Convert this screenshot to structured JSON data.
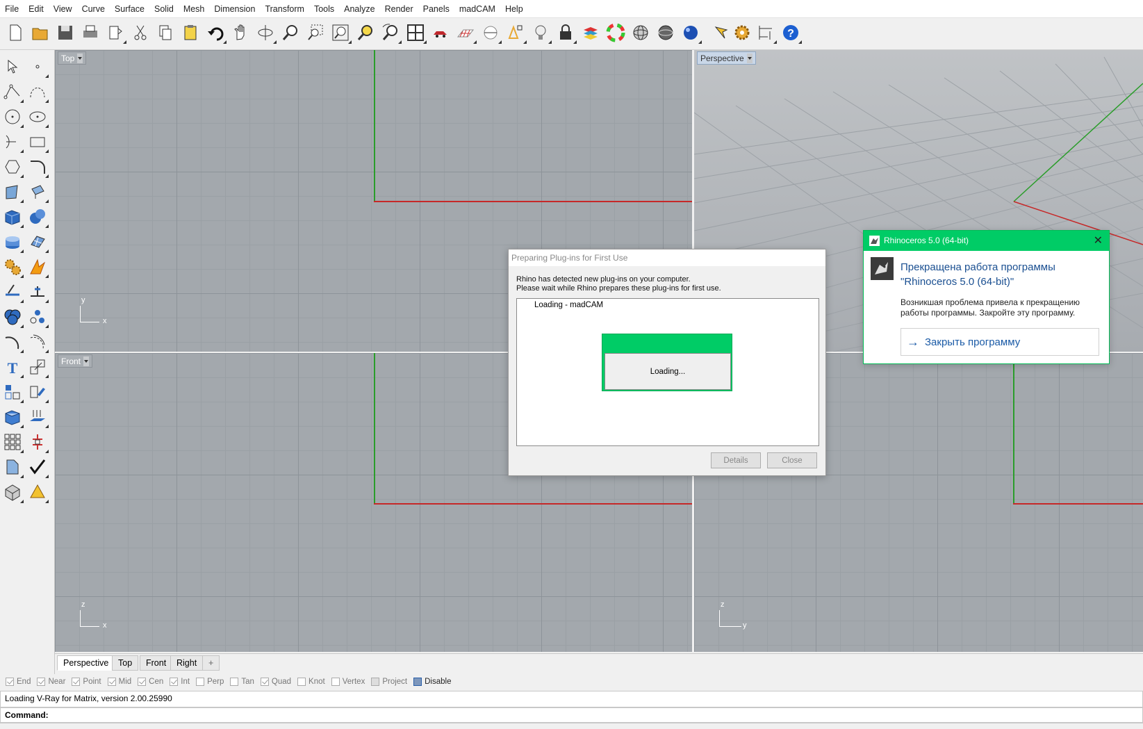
{
  "menu": [
    "File",
    "Edit",
    "View",
    "Curve",
    "Surface",
    "Solid",
    "Mesh",
    "Dimension",
    "Transform",
    "Tools",
    "Analyze",
    "Render",
    "Panels",
    "madCAM",
    "Help"
  ],
  "toolbar_icons": [
    "new-icon",
    "open-icon",
    "save-icon",
    "print-icon",
    "import-icon",
    "cut-icon",
    "copy-icon",
    "paste-icon",
    "undo-icon",
    "pan-icon",
    "rotate-view-icon",
    "zoom-icon",
    "zoom-window-icon",
    "zoom-extents-icon",
    "zoom-selected-icon",
    "zoom-dynamic-icon",
    "four-viewports-icon",
    "car-icon",
    "grid-plane-icon",
    "cplane-icon",
    "osnap-icon",
    "light-icon",
    "lock-icon",
    "layer-icon",
    "color-wheel-icon",
    "wireframe-sphere-icon",
    "shaded-sphere-icon",
    "render-sphere-icon",
    "options-pointer-icon",
    "settings-gear-icon",
    "dimension-icon",
    "help-icon"
  ],
  "viewports": {
    "top": {
      "label": "Top",
      "axis1": "y",
      "axis2": "x"
    },
    "perspective": {
      "label": "Perspective"
    },
    "front": {
      "label": "Front",
      "axis1": "z",
      "axis2": "x"
    },
    "right": {
      "axis1": "z",
      "axis2": "y"
    }
  },
  "tabs": [
    "Perspective",
    "Top",
    "Front",
    "Right",
    "+"
  ],
  "osnaps": [
    {
      "label": "End",
      "checked": true
    },
    {
      "label": "Near",
      "checked": true
    },
    {
      "label": "Point",
      "checked": true
    },
    {
      "label": "Mid",
      "checked": true
    },
    {
      "label": "Cen",
      "checked": true
    },
    {
      "label": "Int",
      "checked": true
    },
    {
      "label": "Perp",
      "checked": false
    },
    {
      "label": "Tan",
      "checked": false
    },
    {
      "label": "Quad",
      "checked": true
    },
    {
      "label": "Knot",
      "checked": false
    },
    {
      "label": "Vertex",
      "checked": false
    },
    {
      "label": "Project",
      "checked": false
    },
    {
      "label": "Disable",
      "checked": false
    }
  ],
  "command": {
    "history": "Loading V-Ray for Matrix, version 2.00.25990",
    "prompt": "Command:"
  },
  "plugin_dialog": {
    "title": "Preparing Plug-ins for First Use",
    "line1": "Rhino has detected new plug-ins on your computer.",
    "line2": "Please wait while Rhino prepares these plug-ins for first use.",
    "item": "Loading - madCAM",
    "details": "Details",
    "close": "Close"
  },
  "loading_box": {
    "text": "Loading..."
  },
  "error_dialog": {
    "title": "Rhinoceros 5.0 (64-bit)",
    "heading1": "Прекращена работа программы",
    "heading2": "\"Rhinoceros 5.0 (64-bit)\"",
    "body1": "Возникшая проблема привела к прекращению",
    "body2": "работы программы. Закройте эту программу.",
    "action": "Закрыть программу",
    "close_glyph": "✕",
    "accent": "#00cc66"
  }
}
